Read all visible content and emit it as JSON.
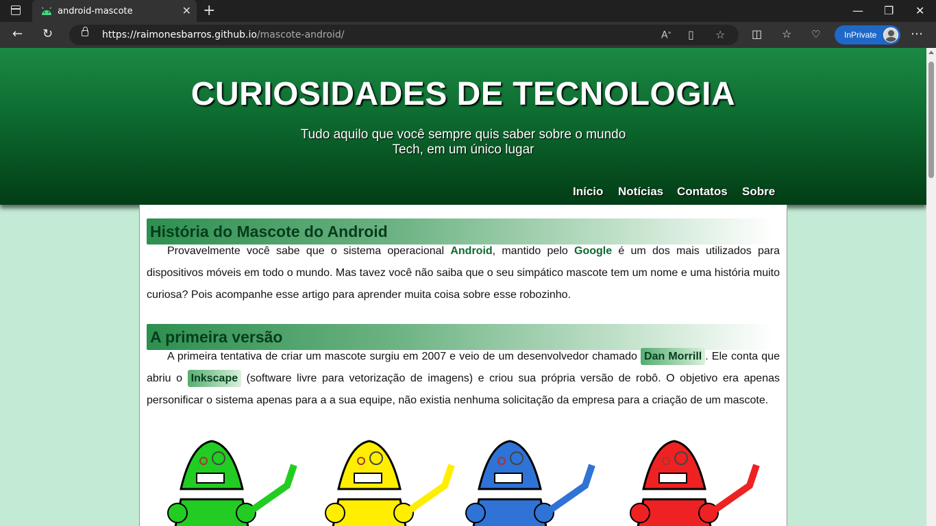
{
  "browser": {
    "tab_title": "android-mascote",
    "url_host": "https://raimonesbarros.github.io",
    "url_path": "/mascote-android/",
    "inprivate_label": "InPrivate"
  },
  "site": {
    "title": "CURIOSIDADES DE TECNOLOGIA",
    "subtitle_line1": "Tudo aquilo que você sempre quis saber sobre o mundo",
    "subtitle_line2": "Tech, em um único lugar",
    "nav": [
      "Início",
      "Notícias",
      "Contatos",
      "Sobre"
    ]
  },
  "article": {
    "section1_title": "História do Mascote do Android",
    "p1": {
      "t1": "Provavelmente você sabe que o sistema operacional ",
      "android": "Android",
      "t2": ", mantido pelo ",
      "google": "Google",
      "t3": " é um dos mais utilizados para dispositivos móveis em todo o mundo. Mas tavez você não saiba que o seu simpático mascote tem um nome e uma história muito curiosa? Pois acompanhe esse artigo para aprender muita coisa sobre esse robozinho."
    },
    "section2_title": "A primeira versão",
    "p2": {
      "t1": "A primeira tentativa de criar um mascote surgiu em 2007 e veio de um desenvolvedor chamado ",
      "dan": "Dan Morrill",
      "t2": ". Ele conta que abriu o ",
      "inkscape": "Inkscape",
      "t3": " (software livre para vetorização de imagens) e criou sua própria versão de robô. O objetivo era apenas personificar o sistema apenas para a a sua equipe, não existia nenhuma solicitação da empresa para a criação de um mascote."
    },
    "mascot_colors": [
      "#22cc22",
      "#ffee00",
      "#2f73d6",
      "#ee2222"
    ]
  }
}
